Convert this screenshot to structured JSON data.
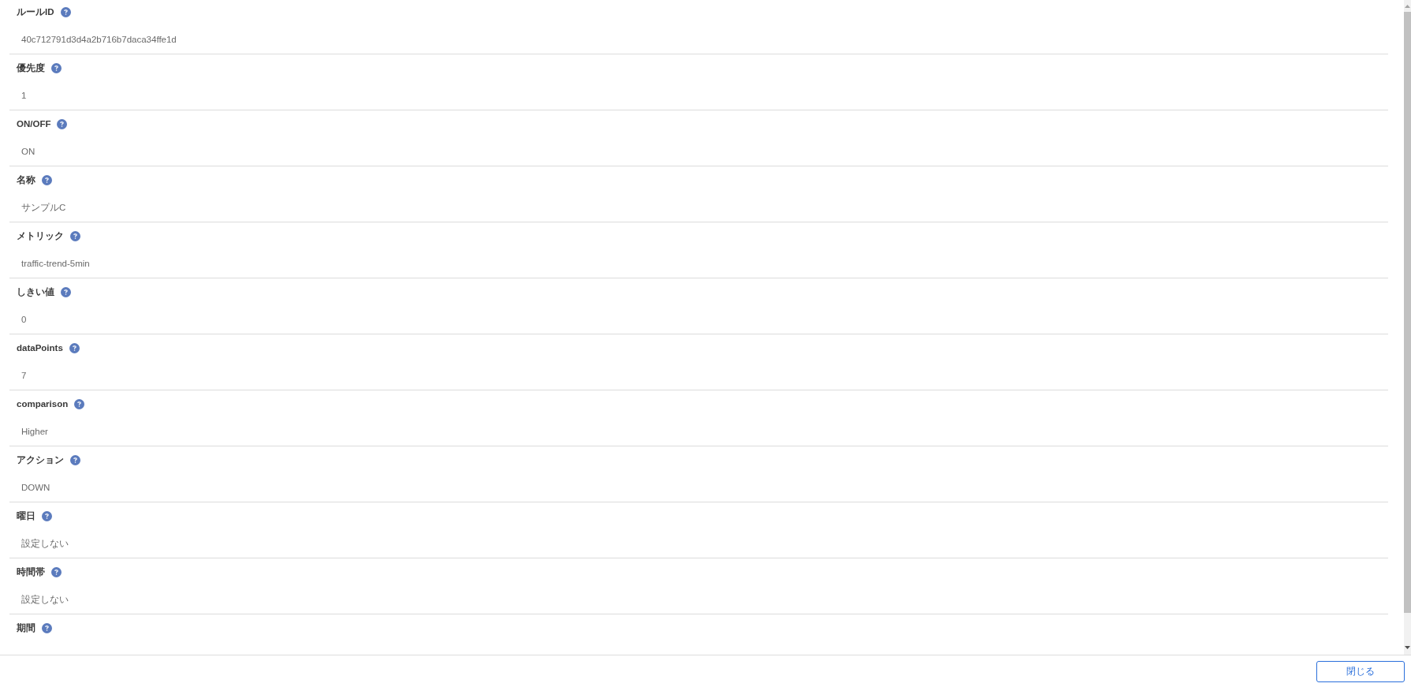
{
  "fields": [
    {
      "label": "ルールID",
      "value": "40c712791d3d4a2b716b7daca34ffe1d"
    },
    {
      "label": "優先度",
      "value": "1"
    },
    {
      "label": "ON/OFF",
      "value": "ON"
    },
    {
      "label": "名称",
      "value": "サンプルC"
    },
    {
      "label": "メトリック",
      "value": "traffic-trend-5min"
    },
    {
      "label": "しきい値",
      "value": "0"
    },
    {
      "label": "dataPoints",
      "value": "7"
    },
    {
      "label": "comparison",
      "value": "Higher"
    },
    {
      "label": "アクション",
      "value": "DOWN"
    },
    {
      "label": "曜日",
      "value": "設定しない"
    },
    {
      "label": "時間帯",
      "value": "設定しない"
    },
    {
      "label": "期間"
    }
  ],
  "footer": {
    "close_button": "閉じる"
  }
}
